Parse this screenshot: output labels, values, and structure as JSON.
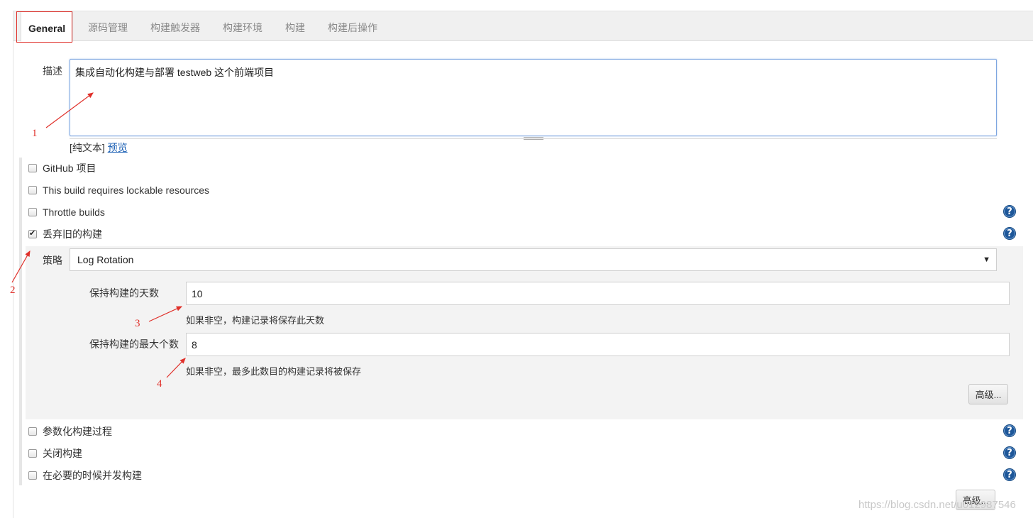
{
  "tabs": [
    {
      "label": "General"
    },
    {
      "label": "源码管理"
    },
    {
      "label": "构建触发器"
    },
    {
      "label": "构建环境"
    },
    {
      "label": "构建"
    },
    {
      "label": "构建后操作"
    }
  ],
  "description": {
    "label": "描述",
    "value": "集成自动化构建与部署 testweb 这个前端项目",
    "format_plain": "[纯文本]",
    "format_preview": "预览"
  },
  "options": [
    {
      "label": "GitHub 项目",
      "checked": false
    },
    {
      "label": "This build requires lockable resources",
      "checked": false
    },
    {
      "label": "Throttle builds",
      "checked": false
    },
    {
      "label": "丢弃旧的构建",
      "checked": true
    }
  ],
  "discard": {
    "strategy_label": "策略",
    "strategy_value": "Log Rotation",
    "days_label": "保持构建的天数",
    "days_value": "10",
    "days_hint": "如果非空，构建记录将保存此天数",
    "max_label": "保持构建的最大个数",
    "max_value": "8",
    "max_hint": "如果非空，最多此数目的构建记录将被保存",
    "advanced_label": "高级..."
  },
  "options2": [
    {
      "label": "参数化构建过程",
      "checked": false
    },
    {
      "label": "关闭构建",
      "checked": false
    },
    {
      "label": "在必要的时候并发构建",
      "checked": false
    }
  ],
  "advanced_label": "高级...",
  "help_glyph": "?",
  "annotations": [
    "1",
    "2",
    "3",
    "4"
  ],
  "watermark": "https://blog.csdn.net/u012987546",
  "colors": {
    "annotation": "#e0302a",
    "help": "#1e5799",
    "link": "#1a5fb4"
  }
}
